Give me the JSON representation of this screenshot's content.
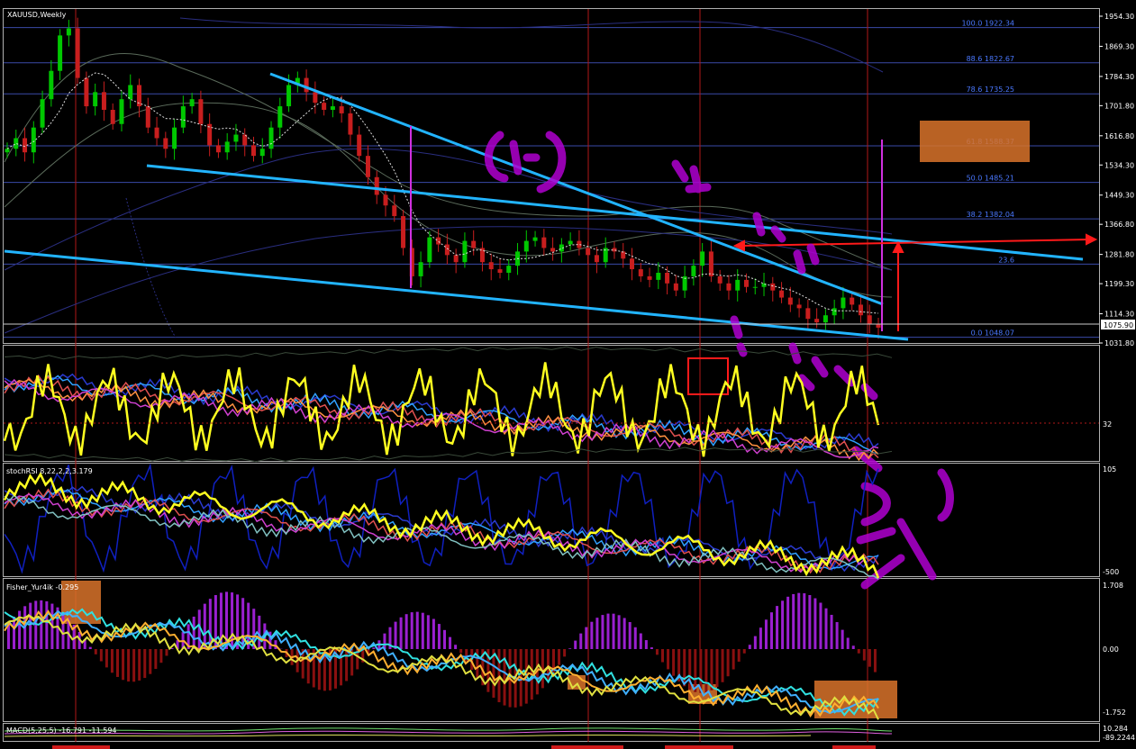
{
  "main_panel": {
    "title": "XAUUSD,Weekly",
    "price_ticks": [
      "1954.30",
      "1869.30",
      "1784.30",
      "1701.80",
      "1616.80",
      "1534.30",
      "1449.30",
      "1366.80",
      "1281.80",
      "1199.30",
      "1114.30",
      "1031.80"
    ],
    "last_price": "1075.90",
    "fib_levels": [
      {
        "label": "100.0 1922.34",
        "price": 1922.34
      },
      {
        "label": "88.6 1822.67",
        "price": 1822.67
      },
      {
        "label": "78.6 1735.25",
        "price": 1735.25
      },
      {
        "label": "61.8 1588.37",
        "price": 1588.37
      },
      {
        "label": "50.0 1485.21",
        "price": 1485.21
      },
      {
        "label": "38.2 1382.04",
        "price": 1382.04
      },
      {
        "label": "23.6",
        "price": 1254.5
      },
      {
        "label": "0.0 1048.07",
        "price": 1048.07
      }
    ],
    "ylim": [
      1031.8,
      1954.3
    ]
  },
  "rsi_panel": {
    "level_label": "32"
  },
  "stoch_panel": {
    "title": "stochRSI 8,22,2,2,3.179",
    "top_label": "105",
    "bottom_label": "-500"
  },
  "fisher_panel": {
    "title": "Fisher_Yur4ik -0.295",
    "top_label": "1.708",
    "mid_label": "0.00",
    "bottom_label": "-1.752"
  },
  "macd_panel": {
    "title": "MACD(5,25,5) -16.791 -11.594",
    "top_label": "10.284",
    "bottom_label": "-89.2244"
  },
  "colors": {
    "background": "#000000",
    "grid": "#7a7a7a",
    "bull": "#00c800",
    "bear": "#c81e1e",
    "trendline": "#22b4ff",
    "fib": "#3a4aa8",
    "vline": "#b01818",
    "annot": "#b000d0",
    "box": "#e07a2a",
    "arrow": "#ff1a1a",
    "yellow": "#ffff20"
  },
  "chart_data": {
    "type": "candlestick",
    "title": "XAUUSD,Weekly",
    "ylim": [
      1031.8,
      1954.3
    ],
    "series": [
      {
        "name": "XAUUSD",
        "values": [
          1580,
          1610,
          1570,
          1640,
          1720,
          1800,
          1900,
          1920,
          1780,
          1700,
          1740,
          1690,
          1650,
          1720,
          1760,
          1700,
          1640,
          1610,
          1580,
          1640,
          1700,
          1720,
          1650,
          1590,
          1570,
          1600,
          1620,
          1590,
          1560,
          1580,
          1640,
          1700,
          1760,
          1780,
          1740,
          1710,
          1690,
          1700,
          1680,
          1620,
          1560,
          1500,
          1450,
          1420,
          1390,
          1300,
          1220,
          1260,
          1330,
          1310,
          1280,
          1260,
          1320,
          1300,
          1260,
          1240,
          1230,
          1250,
          1290,
          1320,
          1330,
          1300,
          1290,
          1310,
          1320,
          1300,
          1280,
          1260,
          1300,
          1290,
          1270,
          1240,
          1220,
          1210,
          1230,
          1200,
          1180,
          1220,
          1250,
          1290,
          1220,
          1200,
          1180,
          1210,
          1190,
          1190,
          1200,
          1180,
          1160,
          1140,
          1130,
          1100,
          1090,
          1110,
          1130,
          1160,
          1140,
          1110,
          1085,
          1075
        ]
      }
    ]
  }
}
